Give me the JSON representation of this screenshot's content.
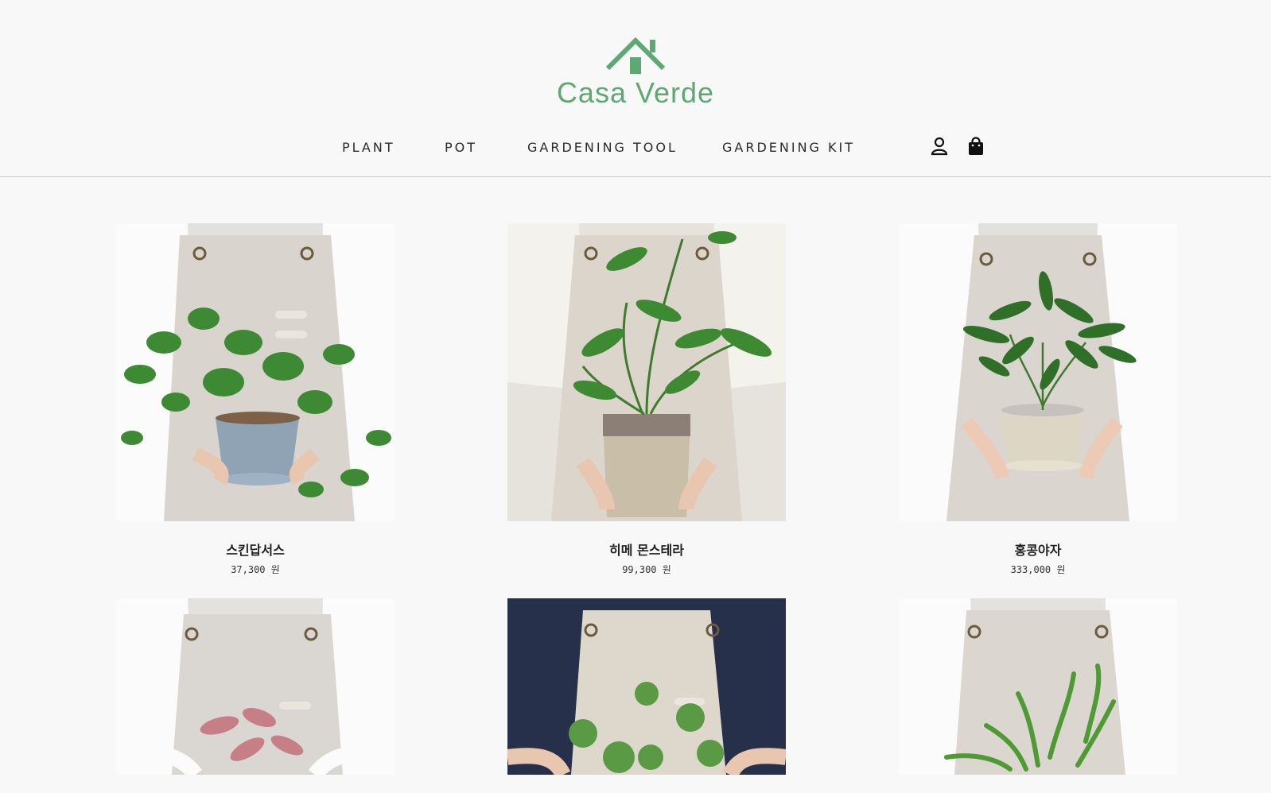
{
  "brand": {
    "name": "Casa Verde",
    "color": "#5ea874"
  },
  "nav": {
    "items": [
      {
        "label": "PLANT"
      },
      {
        "label": "POT"
      },
      {
        "label": "GARDENING TOOL"
      },
      {
        "label": "GARDENING KIT"
      }
    ],
    "icons": [
      "user-icon",
      "shopping-bag-icon"
    ]
  },
  "products": [
    {
      "name": "스킨답서스",
      "price": "37,300 원",
      "image": "pothos-plant-in-blue-pot"
    },
    {
      "name": "히메 몬스테라",
      "price": "99,300 원",
      "image": "hime-monstera-in-ceramic-pot"
    },
    {
      "name": "홍콩야자",
      "price": "333,000 원",
      "image": "schefflera-in-cream-pot"
    },
    {
      "name": "",
      "price": "",
      "image": "pink-syngonium-plant"
    },
    {
      "name": "",
      "price": "",
      "image": "pilea-plant-dark-shirt"
    },
    {
      "name": "",
      "price": "",
      "image": "fern-plant-white-shirt"
    }
  ]
}
